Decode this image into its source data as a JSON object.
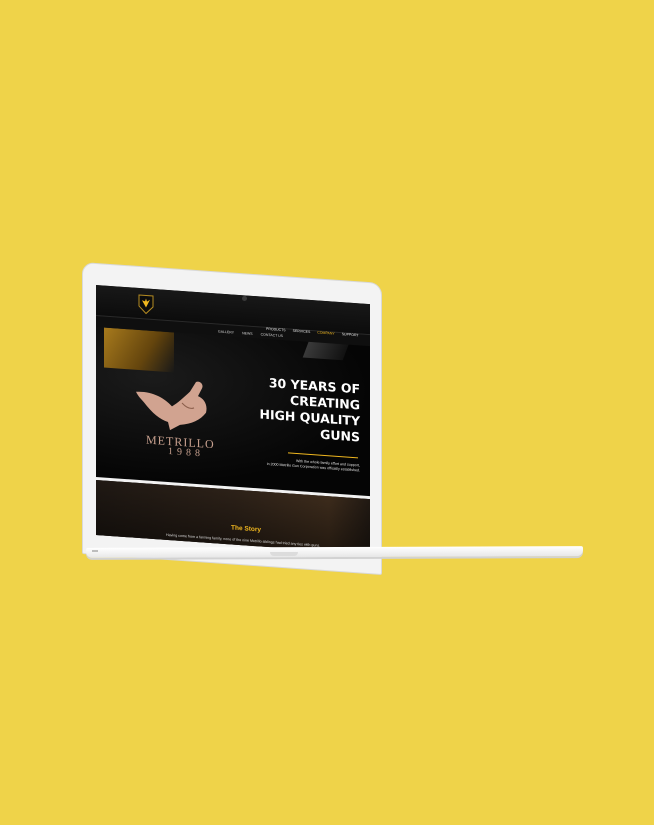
{
  "site": {
    "nav_top": [
      "PRODUCTS",
      "SERVICES",
      "COMPANY",
      "SUPPORT"
    ],
    "nav_top_active_index": 2,
    "nav_sub": [
      "GALLERY",
      "NEWS",
      "CONTACT US"
    ],
    "brand": {
      "name": "METRILLO",
      "year": "1988"
    },
    "hero": {
      "title_lines": [
        "30 YEARS OF",
        "CREATING",
        "HIGH QUALITY",
        "GUNS"
      ],
      "text_lines": [
        "With the whole family effort and support,",
        "in 2000 Metrillo Gun Corporation was officially established."
      ]
    },
    "story": {
      "title": "The Story",
      "text": "Having come from a farming family, none of the nine Metrillo siblings had tried any ties with guns."
    }
  },
  "colors": {
    "background": "#efd349",
    "accent": "#f0b71f",
    "brand": "#c7a08e"
  },
  "icons": {
    "logo": "eagle-shield-icon",
    "camera": "camera-icon"
  }
}
